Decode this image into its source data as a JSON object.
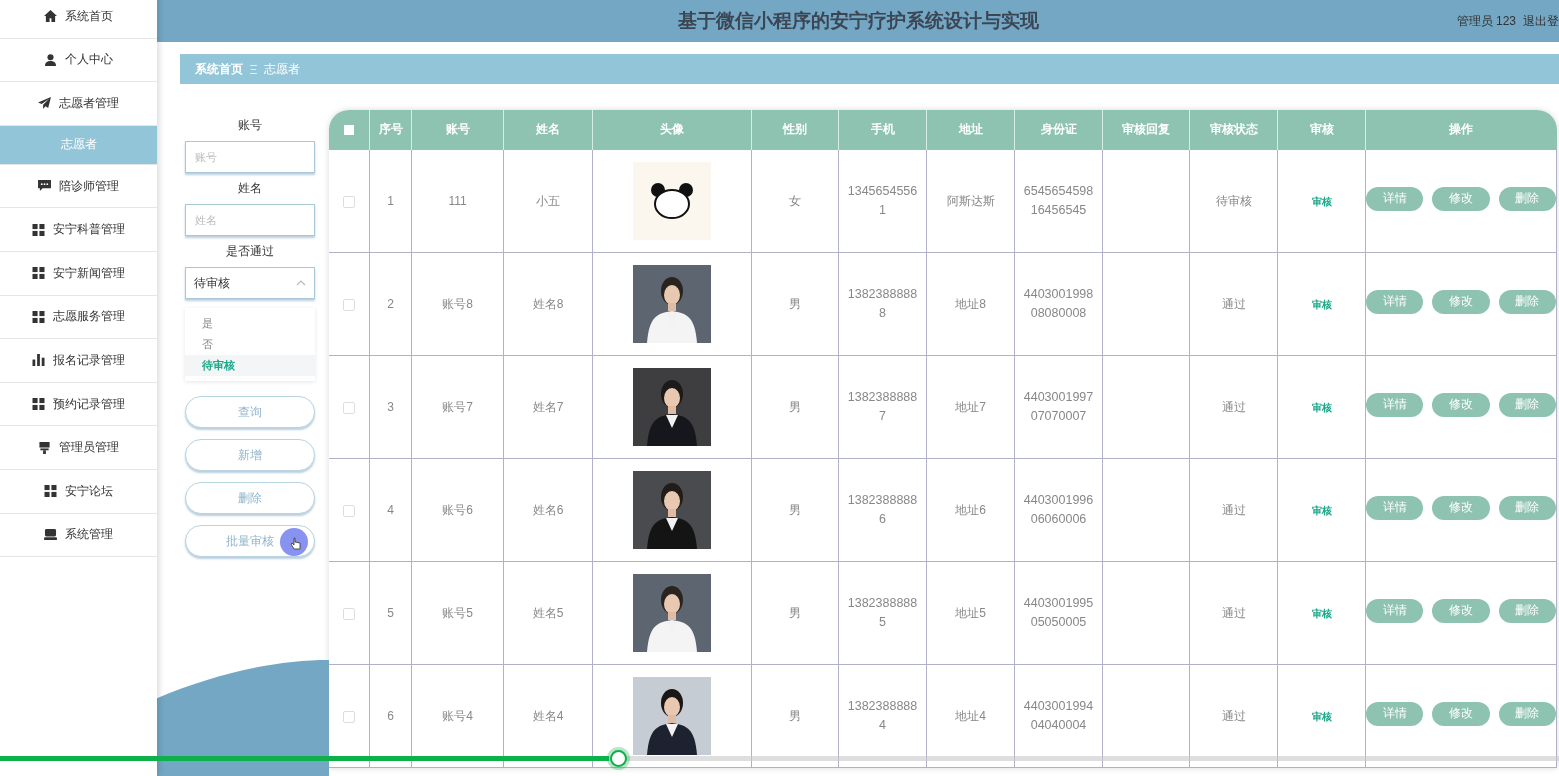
{
  "header": {
    "title": "基于微信小程序的安宁疗护系统设计与实现",
    "user": "管理员 123",
    "logout": "退出登"
  },
  "sidebar": {
    "items": [
      {
        "label": "系统首页",
        "kind": "home",
        "selected": false
      },
      {
        "label": "个人中心",
        "kind": "user",
        "selected": false
      },
      {
        "label": "志愿者管理",
        "kind": "plane",
        "selected": false
      },
      {
        "label": "志愿者",
        "kind": "sub",
        "selected": true
      },
      {
        "label": "陪诊师管理",
        "kind": "chat",
        "selected": false
      },
      {
        "label": "安宁科普管理",
        "kind": "grid",
        "selected": false
      },
      {
        "label": "安宁新闻管理",
        "kind": "grid",
        "selected": false
      },
      {
        "label": "志愿服务管理",
        "kind": "grid",
        "selected": false
      },
      {
        "label": "报名记录管理",
        "kind": "chart",
        "selected": false
      },
      {
        "label": "预约记录管理",
        "kind": "grid",
        "selected": false
      },
      {
        "label": "管理员管理",
        "kind": "stamp",
        "selected": false
      },
      {
        "label": "安宁论坛",
        "kind": "grid",
        "selected": false
      },
      {
        "label": "系统管理",
        "kind": "monitor",
        "selected": false
      }
    ]
  },
  "breadcrumb": [
    {
      "label": "系统首页",
      "current": false
    },
    {
      "label": "志愿者",
      "current": true
    }
  ],
  "filters": {
    "fields": [
      {
        "label": "账号",
        "placeholder": "账号"
      },
      {
        "label": "姓名",
        "placeholder": "姓名"
      }
    ],
    "select": {
      "label": "是否通过",
      "value": "待审核",
      "expanded": true,
      "options": [
        {
          "label": "是",
          "selected": false
        },
        {
          "label": "否",
          "selected": false
        },
        {
          "label": "待审核",
          "selected": true
        }
      ]
    }
  },
  "buttons": [
    "查询",
    "新增",
    "删除",
    "批量审核"
  ],
  "table": {
    "select_all": {
      "checked": false
    },
    "columns": [
      "序号",
      "账号",
      "姓名",
      "头像",
      "性别",
      "手机",
      "地址",
      "身份证",
      "审核回复",
      "审核状态",
      "审核",
      "操作"
    ],
    "rows": [
      {
        "checked": false,
        "index": "1",
        "account": "111",
        "name": "小五",
        "gender": "女",
        "phone": "13456545561",
        "address": "阿斯达斯",
        "id_card": "654565459816456545",
        "status": "待审核",
        "review": "审核",
        "actions": [
          "详情",
          "修改",
          "删除"
        ]
      },
      {
        "checked": false,
        "index": "2",
        "account": "账号8",
        "name": "姓名8",
        "gender": "男",
        "phone": "13823888888",
        "address": "地址8",
        "id_card": "440300199808080008",
        "status": "通过",
        "review": "审核",
        "actions": [
          "详情",
          "修改",
          "删除"
        ]
      },
      {
        "checked": false,
        "index": "3",
        "account": "账号7",
        "name": "姓名7",
        "gender": "男",
        "phone": "13823888887",
        "address": "地址7",
        "id_card": "440300199707070007",
        "status": "通过",
        "review": "审核",
        "actions": [
          "详情",
          "修改",
          "删除"
        ]
      },
      {
        "checked": false,
        "index": "4",
        "account": "账号6",
        "name": "姓名6",
        "gender": "男",
        "phone": "13823888886",
        "address": "地址6",
        "id_card": "440300199606060006",
        "status": "通过",
        "review": "审核",
        "actions": [
          "详情",
          "修改",
          "删除"
        ]
      },
      {
        "checked": false,
        "index": "5",
        "account": "账号5",
        "name": "姓名5",
        "gender": "男",
        "phone": "13823888885",
        "address": "地址5",
        "id_card": "440300199505050005",
        "status": "通过",
        "review": "审核",
        "actions": [
          "详情",
          "修改",
          "删除"
        ]
      },
      {
        "checked": false,
        "index": "6",
        "account": "账号4",
        "name": "姓名4",
        "gender": "男",
        "phone": "13823888884",
        "address": "地址4",
        "id_card": "440300199404040004",
        "status": "通过",
        "review": "审核",
        "actions": [
          "详情",
          "修改",
          "删除"
        ]
      }
    ]
  },
  "player": {
    "level": 0.395
  }
}
